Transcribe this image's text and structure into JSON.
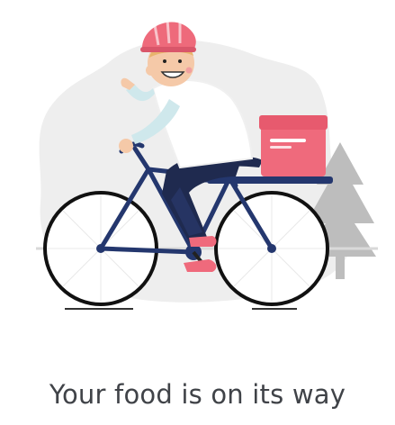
{
  "screen": {
    "message": "Your food is on its way"
  },
  "illustration": {
    "subject": "delivery-courier-on-bicycle",
    "colors": {
      "helmet": "#ee6a7b",
      "delivery_box": "#ef6a7c",
      "trousers": "#1f2a4f",
      "bike_frame": "#24376e",
      "shirt": "#ffffff",
      "sleeve": "#cfe8ec",
      "skin": "#f5c9a8",
      "hair": "#e8b46c",
      "shoes": "#ef6a7c",
      "background_blob": "#eeeeee",
      "tree": "#bdbdbd"
    }
  }
}
